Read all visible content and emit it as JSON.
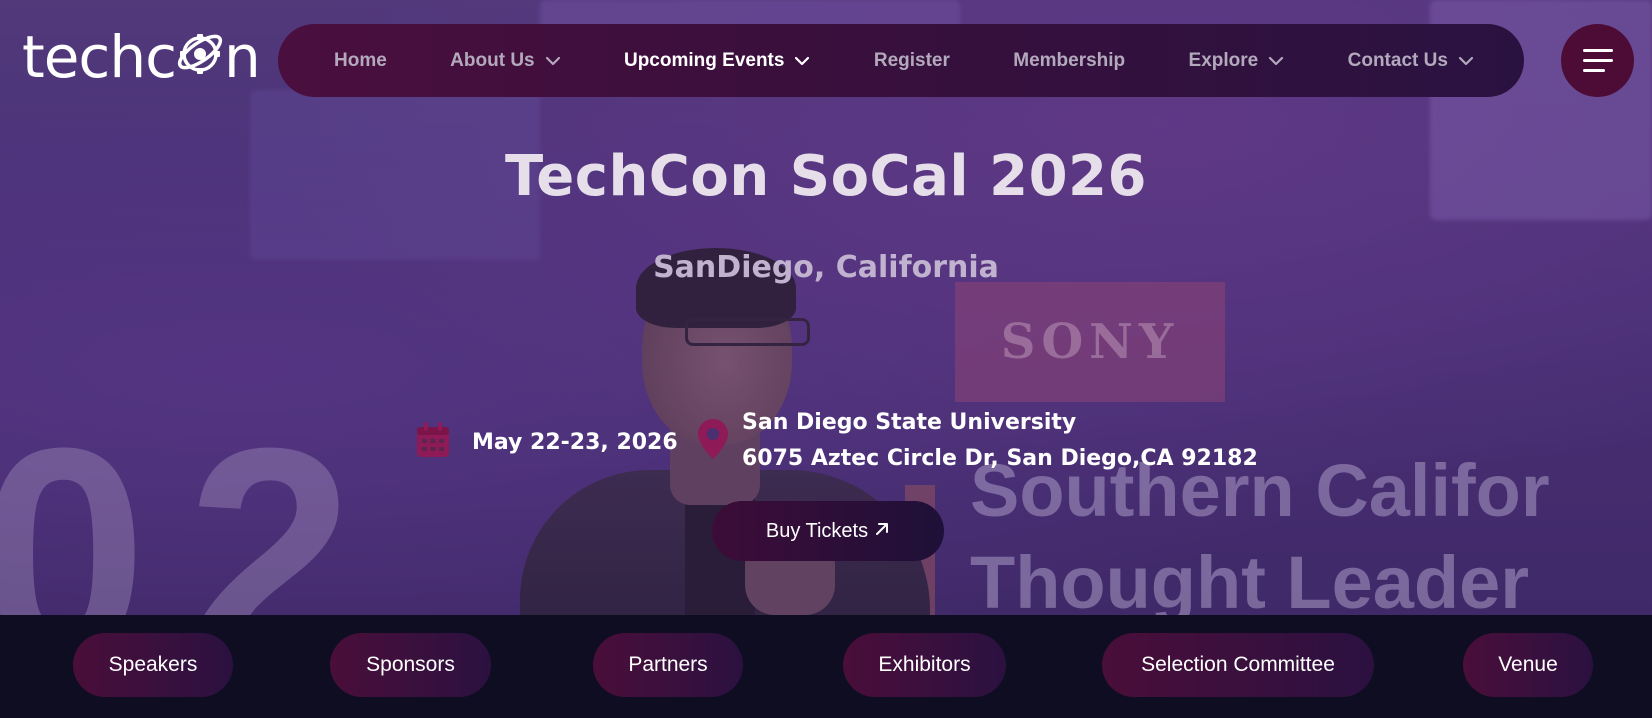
{
  "logo": {
    "text_before": "techc",
    "text_after": "n",
    "icon": "atom-gear-icon"
  },
  "nav": {
    "items": [
      {
        "label": "Home",
        "has_dropdown": false,
        "active": false
      },
      {
        "label": "About Us",
        "has_dropdown": true,
        "active": false
      },
      {
        "label": "Upcoming Events",
        "has_dropdown": true,
        "active": true
      },
      {
        "label": "Register",
        "has_dropdown": false,
        "active": false
      },
      {
        "label": "Membership",
        "has_dropdown": false,
        "active": false
      },
      {
        "label": "Explore",
        "has_dropdown": true,
        "active": false
      },
      {
        "label": "Contact Us",
        "has_dropdown": true,
        "active": false
      }
    ],
    "menu_icon": "hamburger-menu-icon"
  },
  "hero": {
    "title": "TechCon SoCal 2026",
    "subtitle": "SanDiego, California",
    "date": "May 22-23, 2026",
    "date_icon": "calendar-icon",
    "location_icon": "map-pin-icon",
    "venue_name": "San Diego State University",
    "venue_address": "6075 Aztec Circle Dr, San Diego,CA 92182",
    "buy_button": "Buy Tickets",
    "buy_icon": "arrow-up-right-icon",
    "background": {
      "stage_sign": "SONY",
      "banner_line1": "Southern Califor",
      "banner_line2": "Thought Leader",
      "digits": "02"
    }
  },
  "strip": {
    "items": [
      "Speakers",
      "Sponsors",
      "Partners",
      "Exhibitors",
      "Selection Committee",
      "Venue"
    ]
  },
  "colors": {
    "accent": "#8e1a57",
    "nav_bg": "#3a0f3c",
    "strip_bg": "#0e0d22",
    "nav_text": "#b3a9bd"
  }
}
